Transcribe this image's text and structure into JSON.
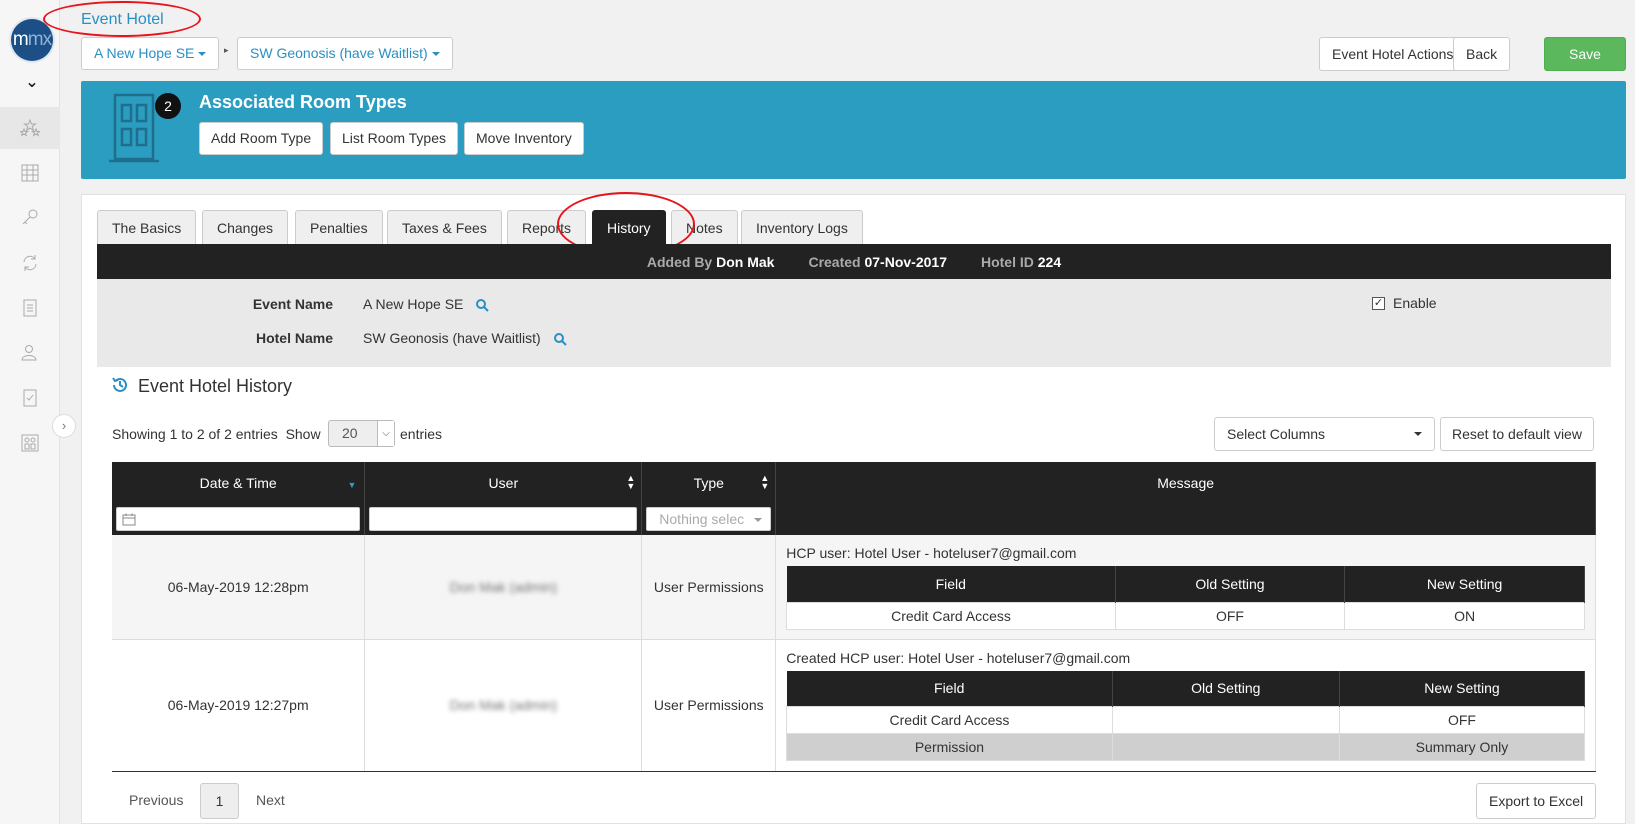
{
  "brand": {
    "logo_text_a": "m",
    "logo_text_b": "mx"
  },
  "header": {
    "title": "Event Hotel",
    "breadcrumb": [
      {
        "label": "A New Hope SE"
      },
      {
        "label": "SW Geonosis (have Waitlist)"
      }
    ],
    "actions_label": "Event Hotel Actions",
    "back_label": "Back",
    "save_label": "Save"
  },
  "banner": {
    "badge": "2",
    "title": "Associated Room Types",
    "buttons": [
      "Add Room Type",
      "List Room Types",
      "Move Inventory"
    ]
  },
  "tabs": [
    {
      "label": "The Basics"
    },
    {
      "label": "Changes"
    },
    {
      "label": "Penalties"
    },
    {
      "label": "Taxes & Fees"
    },
    {
      "label": "Reports"
    },
    {
      "label": "History",
      "active": true
    },
    {
      "label": "Notes"
    },
    {
      "label": "Inventory Logs"
    }
  ],
  "info": {
    "added_by_label": "Added By",
    "added_by": "Don Mak",
    "created_label": "Created",
    "created": "07-Nov-2017",
    "hotel_id_label": "Hotel ID",
    "hotel_id": "224",
    "event_name_label": "Event Name",
    "event_name": "A New Hope SE",
    "hotel_name_label": "Hotel Name",
    "hotel_name": "SW Geonosis (have Waitlist)",
    "enable_label": "Enable",
    "enable_checked": true
  },
  "history": {
    "title": "Event Hotel History",
    "showing": "Showing 1 to 2 of 2 entries",
    "show_label": "Show",
    "page_size": "20",
    "entries_label": "entries",
    "select_columns": "Select Columns",
    "reset_label": "Reset to default view",
    "columns": [
      "Date & Time",
      "User",
      "Type",
      "Message"
    ],
    "type_filter_placeholder": "Nothing selec",
    "rows": [
      {
        "datetime": "06-May-2019 12:28pm",
        "user": "Don Mak (admin)",
        "type": "User Permissions",
        "message": "HCP user: Hotel User - hoteluser7@gmail.com",
        "headers": [
          "Field",
          "Old Setting",
          "New Setting"
        ],
        "changes": [
          {
            "field": "Credit Card Access",
            "old": "OFF",
            "new": "ON"
          }
        ]
      },
      {
        "datetime": "06-May-2019 12:27pm",
        "user": "Don Mak (admin)",
        "type": "User Permissions",
        "message": "Created HCP user: Hotel User - hoteluser7@gmail.com",
        "headers": [
          "Field",
          "Old Setting",
          "New Setting"
        ],
        "changes": [
          {
            "field": "Credit Card Access",
            "old": "",
            "new": "OFF"
          },
          {
            "field": "Permission",
            "old": "",
            "new": "Summary Only"
          }
        ]
      }
    ]
  },
  "pager": {
    "prev": "Previous",
    "current": "1",
    "next": "Next"
  },
  "export_label": "Export to Excel",
  "colors": {
    "accent": "#2a8fc3",
    "banner": "#2a9dc0",
    "save": "#5cb85c",
    "annotation": "#e8141c"
  }
}
